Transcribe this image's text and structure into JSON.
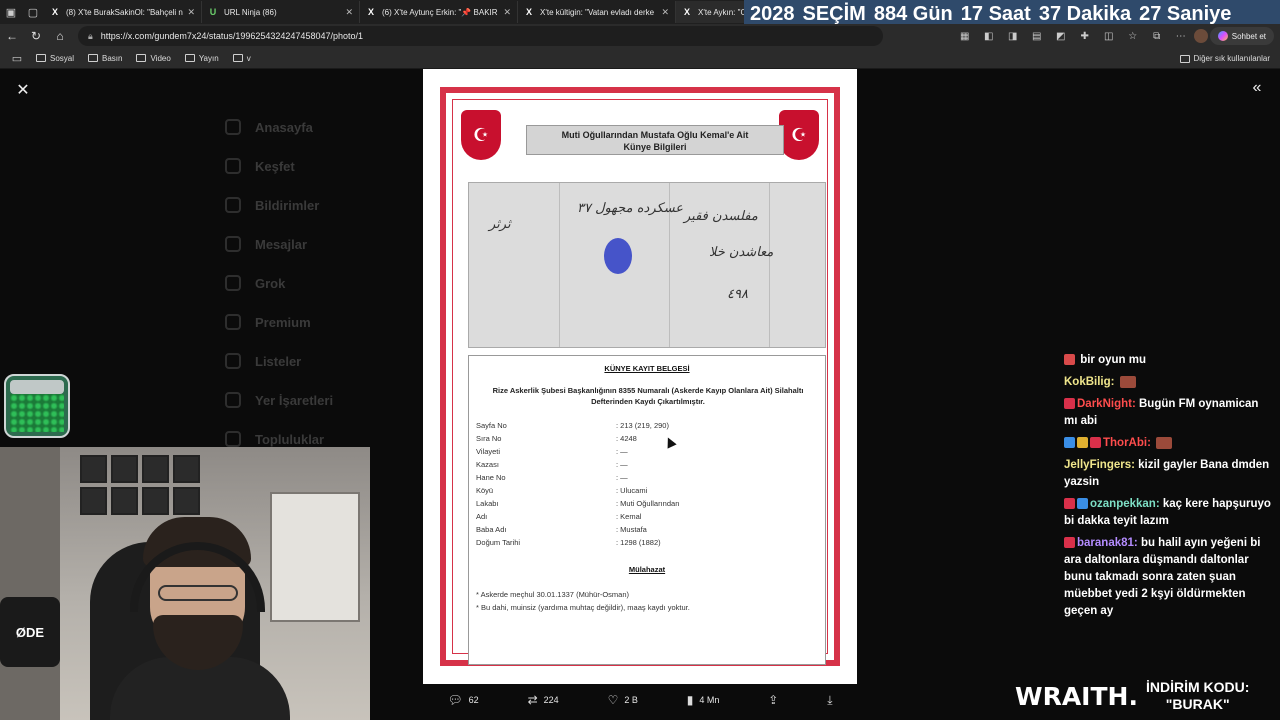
{
  "browser": {
    "tabs": [
      {
        "icon": "X",
        "title": "(8) X'te BurakSakinOl: \"Bahçeli n",
        "active": false
      },
      {
        "icon": "U",
        "title": "URL Ninja (86)",
        "active": false
      },
      {
        "icon": "X",
        "title": "(6) X'te Aytunç Erkin: \"📌 BAKIR",
        "active": false
      },
      {
        "icon": "X",
        "title": "X'te kültigin: \"Vatan evladı derke",
        "active": false
      },
      {
        "icon": "X",
        "title": "X'te Aykın: \"C",
        "active": true
      }
    ],
    "url": "https://x.com/gundem7x24/status/1996254324247458047/photo/1",
    "chat_button": "Sohbet et",
    "bookmarks": [
      "Sosyal",
      "Basın",
      "Video",
      "Yayın",
      "v"
    ],
    "other_bookmarks": "Diğer sık kullanılanlar"
  },
  "countdown": {
    "year": "2028",
    "label": "SEÇİM",
    "days": "884 Gün",
    "hours": "17 Saat",
    "minutes": "37 Dakika",
    "seconds": "27 Saniye"
  },
  "twitter_bg": {
    "nav": [
      "Anasayfa",
      "Keşfet",
      "Bildirimler",
      "Mesajlar",
      "Grok",
      "Premium",
      "Listeler",
      "Yer İşaretleri",
      "Topluluklar"
    ]
  },
  "document": {
    "title_line1": "Muti Oğullarından Mustafa Oğlu Kemal'e Ait",
    "title_line2": "Künye Bilgileri",
    "record_title": "KÜNYE KAYIT BELGESİ",
    "record_sub": "Rize Askerlik Şubesi Başkanlığının 8355 Numaralı (Askerde Kayıp Olanlara Ait) Silahaltı Defterinden Kaydı Çıkartılmıştır.",
    "rows": [
      {
        "k": "Sayfa No",
        "v": ": 213 (219, 290)"
      },
      {
        "k": "Sıra No",
        "v": ": 4248"
      },
      {
        "k": "Vilayeti",
        "v": ": —"
      },
      {
        "k": "Kazası",
        "v": ": —"
      },
      {
        "k": "Hane No",
        "v": ": —"
      },
      {
        "k": "Köyü",
        "v": ": Ulucami"
      },
      {
        "k": "Lakabı",
        "v": ": Muti Oğullarından"
      },
      {
        "k": "Adı",
        "v": ": Kemal"
      },
      {
        "k": "Baba Adı",
        "v": ": Mustafa"
      },
      {
        "k": "Doğum Tarihi",
        "v": ": 1298 (1882)"
      }
    ],
    "notes_title": "Mülahazat",
    "notes": [
      "* Askerde meçhul 30.01.1337 (Mühür-Osman)",
      "* Bu dahi, muinsiz (yardıma muhtaç değildir), maaş kaydı yoktur."
    ]
  },
  "actions": {
    "replies": "62",
    "reposts": "224",
    "likes": "2 B",
    "views": "4 Mn"
  },
  "chat": [
    {
      "user": "",
      "color": "#ffffff",
      "text": "bir oyun mu",
      "badges": [
        "#d94a4a"
      ]
    },
    {
      "user": "KokBilig:",
      "color": "#f0e68c",
      "text": "",
      "emote": true,
      "badges": []
    },
    {
      "user": "DarkNight:",
      "color": "#ff4d4d",
      "text": "Bugün FM oynamican mı abi",
      "badges": [
        "#d9304a"
      ]
    },
    {
      "user": "ThorAbi:",
      "color": "#ff4d4d",
      "text": "",
      "emote": true,
      "badges": [
        "#3a8ee6",
        "#e0b030",
        "#d9304a"
      ]
    },
    {
      "user": "JellyFingers:",
      "color": "#f0e68c",
      "text": "kizil gayler Bana dmden yazsin",
      "badges": []
    },
    {
      "user": "ozanpekkan:",
      "color": "#7ee0c6",
      "text": "kaç kere hapşuruyo bi dakka teyit lazım",
      "badges": [
        "#d9304a",
        "#3a8ee6"
      ]
    },
    {
      "user": "baranak81:",
      "color": "#b48cff",
      "text": "bu halil ayın yeğeni bi ara daltonlara düşmandı daltonlar bunu takmadı sonra zaten şuan müebbet yedi 2 kşyi öldürmekten geçen ay",
      "badges": [
        "#d9304a"
      ]
    }
  ],
  "sponsor": {
    "brand": "WRAITH.",
    "code_label": "İNDİRİM KODU:",
    "code": "\"BURAK\""
  },
  "webcam": {
    "mic_label": "ØDE"
  }
}
